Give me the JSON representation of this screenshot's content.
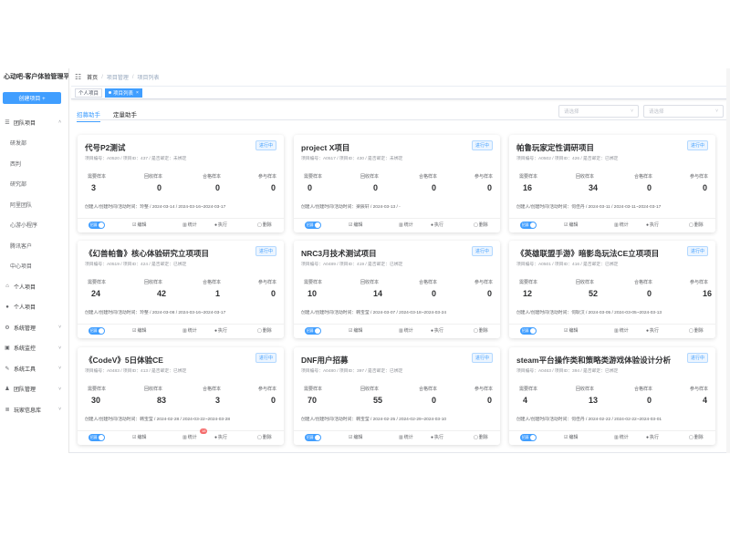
{
  "sidebar": {
    "brand": "心动吧-客户体验管理平台",
    "create_label": "创建项目 +",
    "items": [
      {
        "label": "团队项目",
        "type": "group",
        "icon": "list-icon",
        "chevron": "˄"
      },
      {
        "label": "研发部",
        "type": "sub"
      },
      {
        "label": "西判",
        "type": "sub"
      },
      {
        "label": "研究部",
        "type": "sub"
      },
      {
        "label": "阿里团队",
        "type": "sub"
      },
      {
        "label": "心游小程序",
        "type": "sub"
      },
      {
        "label": "腾讯客户",
        "type": "sub"
      },
      {
        "label": "中心项目",
        "type": "sub"
      },
      {
        "label": "个人项目",
        "type": "group",
        "icon": "home-icon",
        "chevron": ""
      },
      {
        "label": "个人项目",
        "type": "group",
        "icon": "user-icon",
        "chevron": ""
      },
      {
        "label": "系统管理",
        "type": "group",
        "icon": "gear-icon",
        "chevron": "˅"
      },
      {
        "label": "系统监控",
        "type": "group",
        "icon": "monitor-icon",
        "chevron": "˅"
      },
      {
        "label": "系统工具",
        "type": "group",
        "icon": "tool-icon",
        "chevron": "˅"
      },
      {
        "label": "团队管理",
        "type": "group",
        "icon": "team-icon",
        "chevron": "˅"
      },
      {
        "label": "玩家信息库",
        "type": "group",
        "icon": "database-icon",
        "chevron": "˅"
      }
    ]
  },
  "breadcrumb": {
    "home": "首页",
    "level2": "项目管理",
    "level3": "项目列表"
  },
  "tags": [
    {
      "label": "个人项目",
      "active": false
    },
    {
      "label": "项目列表",
      "active": true
    }
  ],
  "subtabs": [
    {
      "label": "招募助手",
      "active": true
    },
    {
      "label": "定量助手",
      "active": false
    }
  ],
  "filters": [
    {
      "placeholder": "请选择"
    },
    {
      "placeholder": "请选择"
    }
  ],
  "stat_labels": [
    "需要样本",
    "回收样本",
    "合格样本",
    "参与样本"
  ],
  "actions": {
    "toggle": "招募",
    "edit": "编辑",
    "stats": "统计",
    "execute": "执行",
    "delete": "删除"
  },
  "cards": [
    {
      "title": "代号P2测试",
      "status": "进行中",
      "meta": "项目编号：A0520 / 项目ID：437 / 是否邮定：未绑定",
      "stats": [
        "3",
        "0",
        "0",
        "0"
      ],
      "info": "创建人/创建时间/活动时间：玲整 / 2024-03-14 / 2024-03-16~2024-03-17",
      "badge": ""
    },
    {
      "title": "project X项目",
      "status": "进行中",
      "meta": "项目编号：A0517 / 项目ID：430 / 是否邮定：未绑定",
      "stats": [
        "0",
        "0",
        "0",
        "0"
      ],
      "info": "创建人/创建时间/活动时间：梁辰轩 / 2024-03-13 / -",
      "badge": ""
    },
    {
      "title": "帕鲁玩家定性调研项目",
      "status": "进行中",
      "meta": "项目编号：A0502 / 项目ID：426 / 是否邮定：已绑定",
      "stats": [
        "16",
        "34",
        "0",
        "0"
      ],
      "info": "创建人/创建时间/活动时间：何佳丹 / 2024-03-11 / 2024-03-11~2024-03-17",
      "badge": ""
    },
    {
      "title": "《幻兽帕鲁》核心体验研究立项项目",
      "status": "进行中",
      "meta": "项目编号：A0519 / 项目ID：424 / 是否邮定：已绑定",
      "stats": [
        "24",
        "42",
        "1",
        "0"
      ],
      "info": "创建人/创建时间/活动时间：玲整 / 2024-03-08 / 2024-03-16~2024-03-17",
      "badge": ""
    },
    {
      "title": "NRC3月技术测试项目",
      "status": "进行中",
      "meta": "项目编号：A0489 / 项目ID：419 / 是否邮定：已绑定",
      "stats": [
        "10",
        "14",
        "0",
        "0"
      ],
      "info": "创建人/创建时间/活动时间：韩宝莹 / 2024-03-07 / 2024-03-18~2024-03-24",
      "badge": ""
    },
    {
      "title": "《英雄联盟手游》暗影岛玩法CE立项项目",
      "status": "进行中",
      "meta": "项目编号：A0501 / 项目ID：416 / 是否邮定：已绑定",
      "stats": [
        "12",
        "52",
        "0",
        "16"
      ],
      "info": "创建人/创建时间/活动时间：何耿汉 / 2024-03-05 / 2024-03-05~2024-03-13",
      "badge": ""
    },
    {
      "title": "《CodeV》5日体验CE",
      "status": "进行中",
      "meta": "项目编号：A0483 / 项目ID：413 / 是否邮定：已绑定",
      "stats": [
        "30",
        "83",
        "3",
        "0"
      ],
      "info": "创建人/创建时间/活动时间：韩宝莹 / 2024-02-28 / 2024-03-22~2024-03-28",
      "badge": "18"
    },
    {
      "title": "DNF用户招募",
      "status": "进行中",
      "meta": "项目编号：A0480 / 项目ID：397 / 是否邮定：已绑定",
      "stats": [
        "70",
        "55",
        "0",
        "0"
      ],
      "info": "创建人/创建时间/活动时间：韩宝莹 / 2024-02-25 / 2024-02-29~2024-03-10",
      "badge": ""
    },
    {
      "title": "steam平台操作类和策略类游戏体验设计分析",
      "status": "进行中",
      "meta": "项目编号：A0463 / 项目ID：394 / 是否邮定：已绑定",
      "stats": [
        "4",
        "13",
        "0",
        "4"
      ],
      "info": "创建人/创建时间/活动时间：何佳丹 / 2024-02-22 / 2024-02-22~2024-03-01",
      "badge": ""
    }
  ]
}
